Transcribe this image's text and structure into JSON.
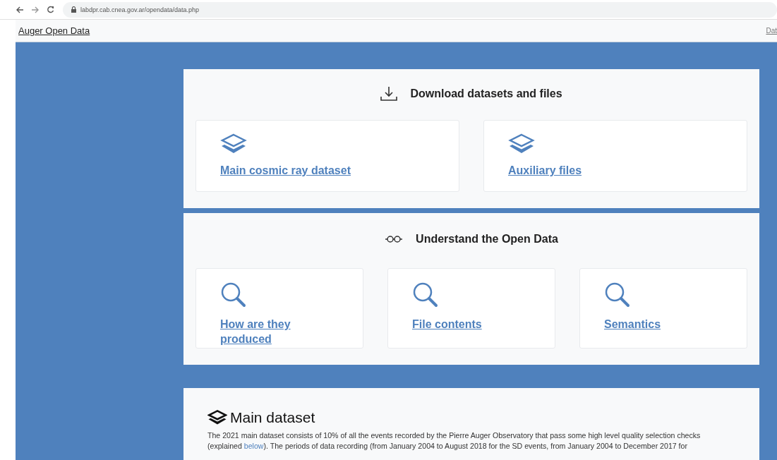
{
  "browser": {
    "url": "labdpr.cab.cnea.gov.ar/opendata/data.php"
  },
  "nav": {
    "brand": "Auger Open Data",
    "links": [
      "Dat"
    ]
  },
  "sections": [
    {
      "kind": "download",
      "title": "Download datasets and files",
      "cards": [
        {
          "label": "Main cosmic ray dataset"
        },
        {
          "label": "Auxiliary files"
        }
      ]
    },
    {
      "kind": "understand",
      "title": "Understand the Open Data",
      "cards": [
        {
          "label": "How are they produced"
        },
        {
          "label": "File contents"
        },
        {
          "label": "Semantics"
        }
      ]
    }
  ],
  "main_dataset": {
    "title": "Main dataset",
    "text_before": "The 2021 main dataset consists of 10% of all the events recorded by the Pierre Auger Observatory that pass some high level quality selection checks (explained ",
    "link": "below",
    "text_after": "). The periods of data recording (from January 2004 to August 2018 for the SD events, from January 2004 to December 2017 for"
  }
}
